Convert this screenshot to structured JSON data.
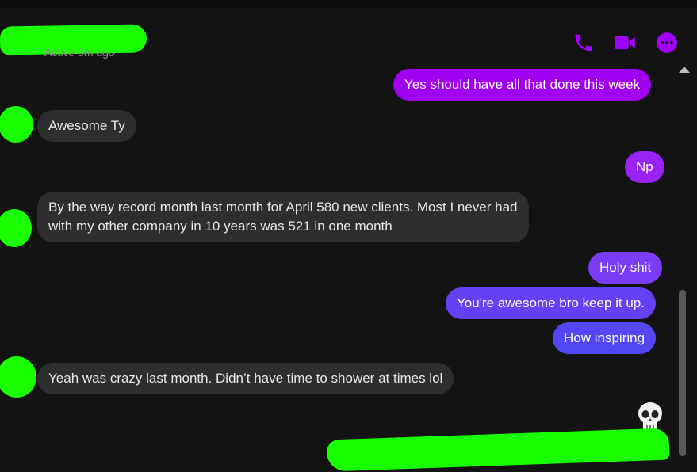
{
  "header": {
    "status": "Active 5m ago",
    "icons": [
      "phone-icon",
      "video-icon",
      "more-icon"
    ],
    "accent_color": "#a200ff"
  },
  "messages": [
    {
      "side": "out",
      "text": "Yes should have all that done this week",
      "color": "#a000f0"
    },
    {
      "side": "in",
      "text": "Awesome Ty"
    },
    {
      "side": "out",
      "text": "Np",
      "color": "#9a22f4"
    },
    {
      "side": "in",
      "lines": [
        "By the way record month last month for April  580 new clients. Most I never had",
        "with my other company in 10 years was 521 in one month"
      ]
    },
    {
      "side": "out",
      "text": "Holy shit",
      "color": "#7b3cf6"
    },
    {
      "side": "out",
      "text": "You're awesome bro keep it up.",
      "color": "#6541f6"
    },
    {
      "side": "out",
      "text": "How inspiring",
      "color": "#5148f4"
    },
    {
      "side": "in",
      "text": "Yeah was crazy last month. Didn’t have time to shower at times lol"
    }
  ],
  "reaction": {
    "emoji": "💀",
    "icon": "skull-icon"
  },
  "redaction_color": "#19ff00"
}
